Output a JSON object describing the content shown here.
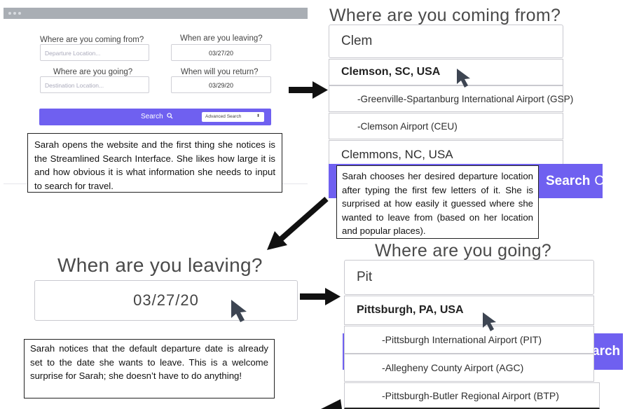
{
  "search_panel": {
    "from_label": "Where are you coming from?",
    "from_placeholder": "Departure Location...",
    "leaving_label": "When are you leaving?",
    "leaving_value": "03/27/20",
    "to_label": "Where are you going?",
    "to_placeholder": "Destination Location...",
    "return_label": "When will you return?",
    "return_value": "03/29/20",
    "search_button": "Search",
    "advanced_search": "Advanced Search"
  },
  "captions": {
    "c1": "Sarah opens the website and the first thing she notices is the Streamlined Search Interface. She likes how large it is and how obvious it is what information she needs to input to search for travel.",
    "c2": "Sarah chooses her desired departure location after typing the first few letters of it. She is surprised at how easily it guessed where she wanted to leave from (based on her location and popular places).",
    "c3": "Sarah notices that the default departure date is already set to the date she wants to leave. This is a welcome surprise for Sarah; she doesn’t have to do anything!"
  },
  "departure_autocomplete": {
    "heading": "Where are you coming from?",
    "typed": "Clem",
    "city1": "Clemson, SC, USA",
    "airport1": "-Greenville-Spartanburg International Airport (GSP)",
    "airport2": "-Clemson Airport (CEU)",
    "city2": "Clemmons, NC, USA",
    "search_fragment": "Search"
  },
  "date_zoom": {
    "heading": "When are you leaving?",
    "value": "03/27/20"
  },
  "destination_autocomplete": {
    "heading": "Where are you going?",
    "typed": "Pit",
    "city1": "Pittsburgh, PA, USA",
    "airport1": "-Pittsburgh International Airport (PIT)",
    "airport2": "-Allegheny County Airport (AGC)",
    "airport3": "-Pittsburgh-Butler Regional Airport (BTP)",
    "search_fragment": "arch"
  },
  "colors": {
    "accent": "#6f60f0",
    "arrow": "#111111",
    "cursor": "#3d4552"
  }
}
